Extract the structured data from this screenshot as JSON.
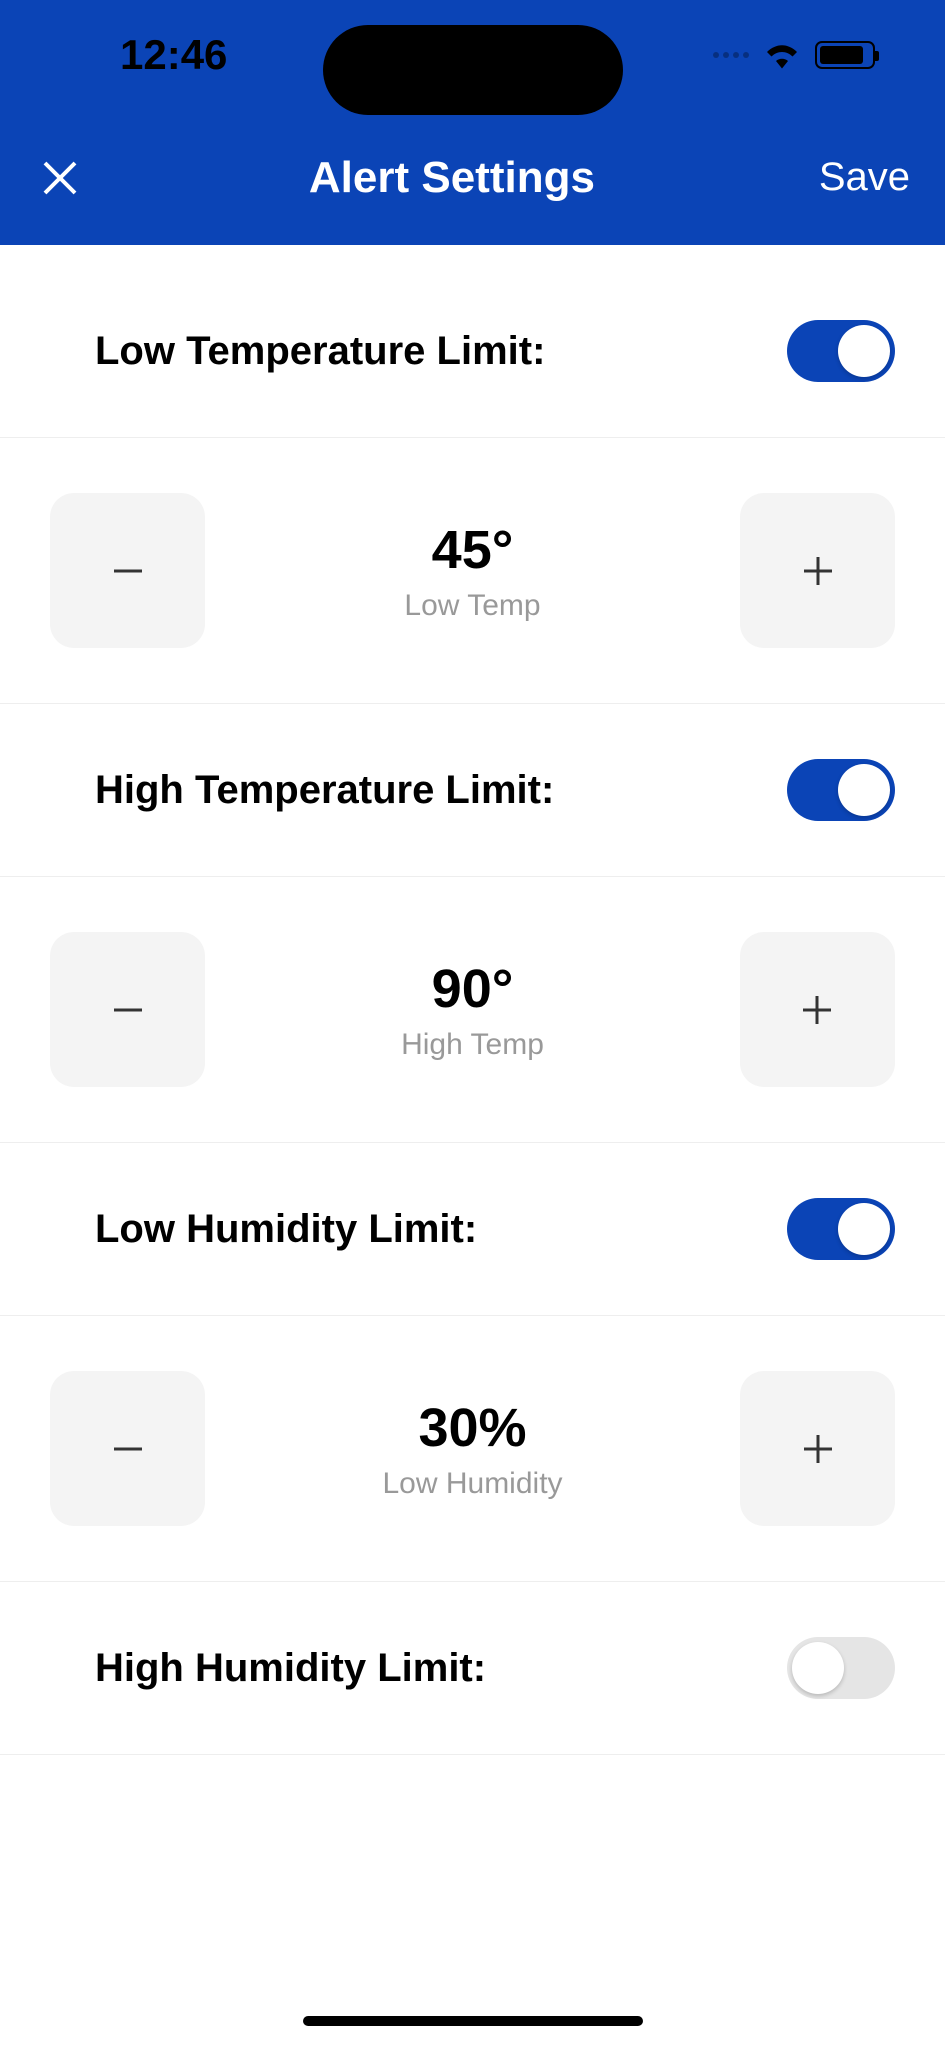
{
  "status": {
    "time": "12:46"
  },
  "nav": {
    "title": "Alert Settings",
    "save": "Save"
  },
  "settings": {
    "lowTemp": {
      "label": "Low Temperature Limit:",
      "enabled": true,
      "value": "45°",
      "caption": "Low Temp"
    },
    "highTemp": {
      "label": "High Temperature Limit:",
      "enabled": true,
      "value": "90°",
      "caption": "High Temp"
    },
    "lowHumidity": {
      "label": "Low Humidity Limit:",
      "enabled": true,
      "value": "30%",
      "caption": "Low Humidity"
    },
    "highHumidity": {
      "label": "High Humidity Limit:",
      "enabled": false
    }
  }
}
